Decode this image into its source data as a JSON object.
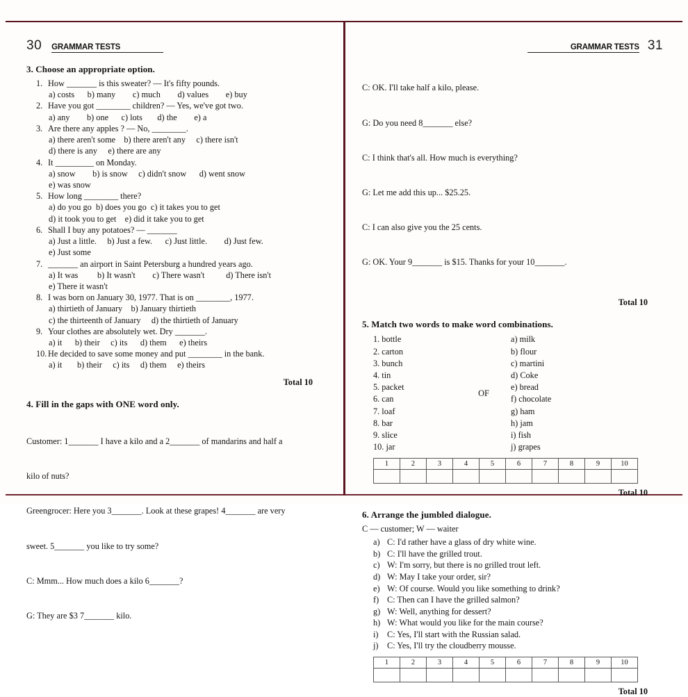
{
  "pages": {
    "left": {
      "folio": "30",
      "runhead": "GRAMMAR TESTS"
    },
    "right": {
      "folio": "31",
      "runhead": "GRAMMAR TESTS"
    }
  },
  "ex3": {
    "title": "3. Choose an appropriate option.",
    "total": "Total 10",
    "questions": [
      {
        "num": "1.",
        "stem": "How _______ is this sweater? — It's fifty pounds.",
        "options": "a) costs      b) many        c) much        d) values        e) buy"
      },
      {
        "num": "2.",
        "stem": "Have you got ________ children? — Yes, we've got two.",
        "options": "a) any        b) one      c) lots       d) the        e) a"
      },
      {
        "num": "3.",
        "stem": "Are there any apples ? — No, ________.",
        "options": "a) there aren't some    b) there aren't any     c) there isn't\nd) there is any     e) there are any"
      },
      {
        "num": "4.",
        "stem": "It _________ on Monday.",
        "options": "a) snow        b) is snow     c) didn't snow      d) went snow\ne) was snow"
      },
      {
        "num": "5.",
        "stem": "How long ________ there?",
        "options": "a) do you go  b) does you go  c) it takes you to get\nd) it took you to get    e) did it take you to get"
      },
      {
        "num": "6.",
        "stem": "Shall I buy any potatoes? — _______",
        "options": "a) Just a little.     b) Just a few.      c) Just little.        d) Just few.\ne) Just some"
      },
      {
        "num": "7.",
        "stem": "_______ an airport in Saint Petersburg a hundred years ago.",
        "options": "a) It was         b) It wasn't        c) There wasn't          d) There isn't\ne) There it wasn't"
      },
      {
        "num": "8.",
        "stem": "I was born on January 30, 1977. That is on ________, 1977.",
        "options": "a) thirtieth of January    b) January thirtieth\nc) the thirteenth of January     d) the thirtieth of January"
      },
      {
        "num": "9.",
        "stem": "Your clothes are absolutely wet. Dry _______.",
        "options": "a) it      b) their     c) its      d) them      e) theirs"
      },
      {
        "num": "10.",
        "stem": "He decided to save some money and put ________ in the bank.",
        "options": "a) it       b) their     c) its     d) them     e) theirs"
      }
    ]
  },
  "ex4": {
    "title": "4. Fill in the gaps with ONE word only.",
    "total": "Total 10",
    "lines_left": [
      "Customer: 1_______ I have a kilo and a 2_______ of mandarins and half a",
      "kilo of nuts?",
      "Greengrocer: Here you 3_______. Look at these grapes! 4_______ are very",
      "sweet. 5_______ you like to try some?",
      "C: Mmm... How much does a kilo 6_______?",
      "G: They are $3 7_______ kilo."
    ],
    "lines_right": [
      "C: OK. I'll take half a kilo, please.",
      "G: Do you need 8_______ else?",
      "C: I think that's all. How much is everything?",
      "G: Let me add this up... $25.25.",
      "C: I can also give you the 25 cents.",
      "G: OK. Your 9_______ is $15. Thanks for your 10_______."
    ]
  },
  "ex5": {
    "title": "5. Match two words to make word combinations.",
    "middle_word": "OF",
    "total": "Total 10",
    "left_items": [
      "1. bottle",
      "2. carton",
      "3. bunch",
      "4. tin",
      "5. packet",
      "6. can",
      "7. loaf",
      "8. bar",
      "9. slice",
      "10. jar"
    ],
    "right_items": [
      "a) milk",
      "b) flour",
      "c) martini",
      "d) Coke",
      "e) bread",
      "f) chocolate",
      "g) ham",
      "h) jam",
      "i) fish",
      "j) grapes"
    ],
    "grid_headers": [
      "1",
      "2",
      "3",
      "4",
      "5",
      "6",
      "7",
      "8",
      "9",
      "10"
    ],
    "grid_answers": [
      "",
      "",
      "",
      "",
      "",
      "",
      "",
      "",
      "",
      ""
    ]
  },
  "ex6": {
    "title": "6. Arrange the jumbled dialogue.",
    "speakers": "C — customer; W — waiter",
    "total": "Total 10",
    "items": [
      {
        "letter": "a)",
        "text": "C: I'd rather have a glass of dry white wine."
      },
      {
        "letter": "b)",
        "text": "C: I'll have the grilled trout."
      },
      {
        "letter": "c)",
        "text": "W: I'm sorry, but there is no grilled trout left."
      },
      {
        "letter": "d)",
        "text": "W: May I take your order, sir?"
      },
      {
        "letter": "e)",
        "text": "W: Of course. Would you like something to drink?"
      },
      {
        "letter": "f)",
        "text": "C: Then can I have the grilled salmon?"
      },
      {
        "letter": "g)",
        "text": "W: Well, anything for dessert?"
      },
      {
        "letter": "h)",
        "text": "W: What would you like for the main course?"
      },
      {
        "letter": "i)",
        "text": "C: Yes, I'll start with the Russian salad."
      },
      {
        "letter": "j)",
        "text": "C: Yes, I'll try the cloudberry mousse."
      }
    ],
    "grid_headers": [
      "1",
      "2",
      "3",
      "4",
      "5",
      "6",
      "7",
      "8",
      "9",
      "10"
    ],
    "grid_answers": [
      "",
      "",
      "",
      "",
      "",
      "",
      "",
      "",
      "",
      ""
    ]
  },
  "colors": {
    "frame": "#5a1420",
    "paper": "#fefdfb",
    "ink": "#111111"
  }
}
